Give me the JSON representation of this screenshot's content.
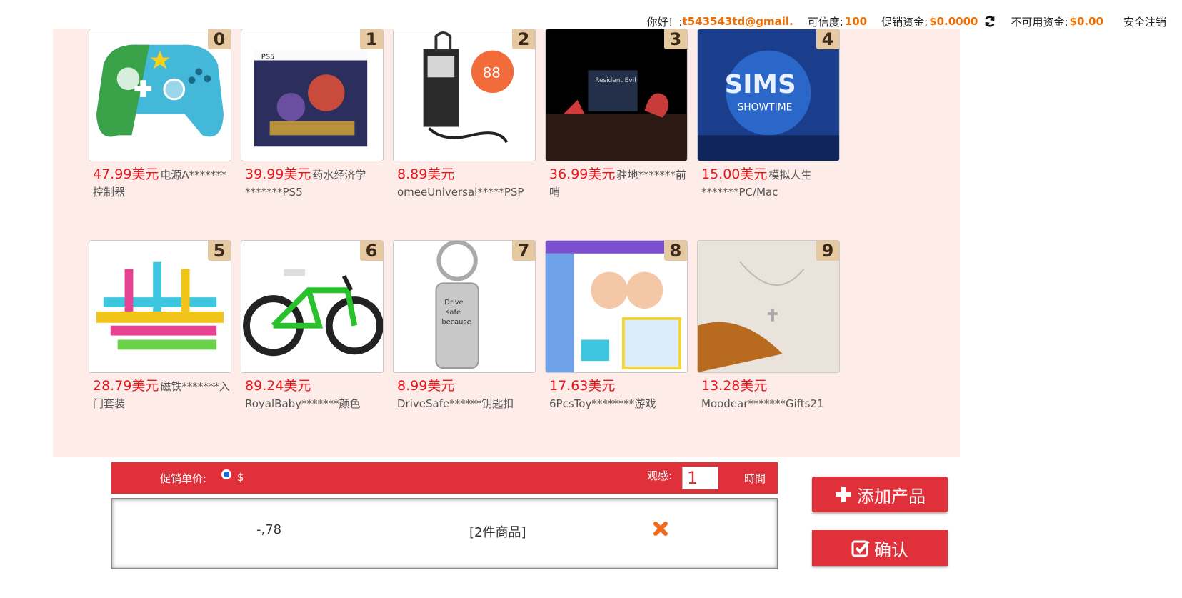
{
  "topbar": {
    "greeting": "你好！:",
    "email": "t543543td@gmail.",
    "credit_label": "可信度:",
    "credit_value": "100",
    "promo_label": "促销资金:",
    "promo_value": "$0.0000",
    "refresh_icon": "refresh-icon",
    "unavailable_label": "不可用资金:",
    "unavailable_value": "$0.00",
    "logout": "安全注销"
  },
  "products": [
    {
      "num": "0",
      "price": "47.99美元",
      "name": "电源A*******控制器"
    },
    {
      "num": "1",
      "price": "39.99美元",
      "name": "药水经济学*******PS5"
    },
    {
      "num": "2",
      "price": "8.89美元",
      "name": "omeeUniversal*****PSP"
    },
    {
      "num": "3",
      "price": "36.99美元",
      "name": "驻地*******前哨"
    },
    {
      "num": "4",
      "price": "15.00美元",
      "name": "模拟人生*******PC/Mac"
    },
    {
      "num": "5",
      "price": "28.79美元",
      "name": "磁铁*******入门套装"
    },
    {
      "num": "6",
      "price": "89.24美元",
      "name": "RoyalBaby*******颜色"
    },
    {
      "num": "7",
      "price": "8.99美元",
      "name": "DriveSafe******钥匙扣"
    },
    {
      "num": "8",
      "price": "17.63美元",
      "name": "6PcsToy********游戏"
    },
    {
      "num": "9",
      "price": "13.28美元",
      "name": "Moodear*******Gifts21"
    }
  ],
  "controls": {
    "unit_price_label": "促销单价:",
    "currency": "$",
    "view_label": "观感:",
    "view_value": "1",
    "time_label": "時間"
  },
  "list": {
    "value": "-,78",
    "count": "[2件商品]"
  },
  "buttons": {
    "add": "添加产品",
    "confirm": "确认"
  },
  "colors": {
    "accent": "#e0313a",
    "price": "#e8161b",
    "topbar_value": "#ef6c00",
    "panel_bg": "#fdece8"
  }
}
